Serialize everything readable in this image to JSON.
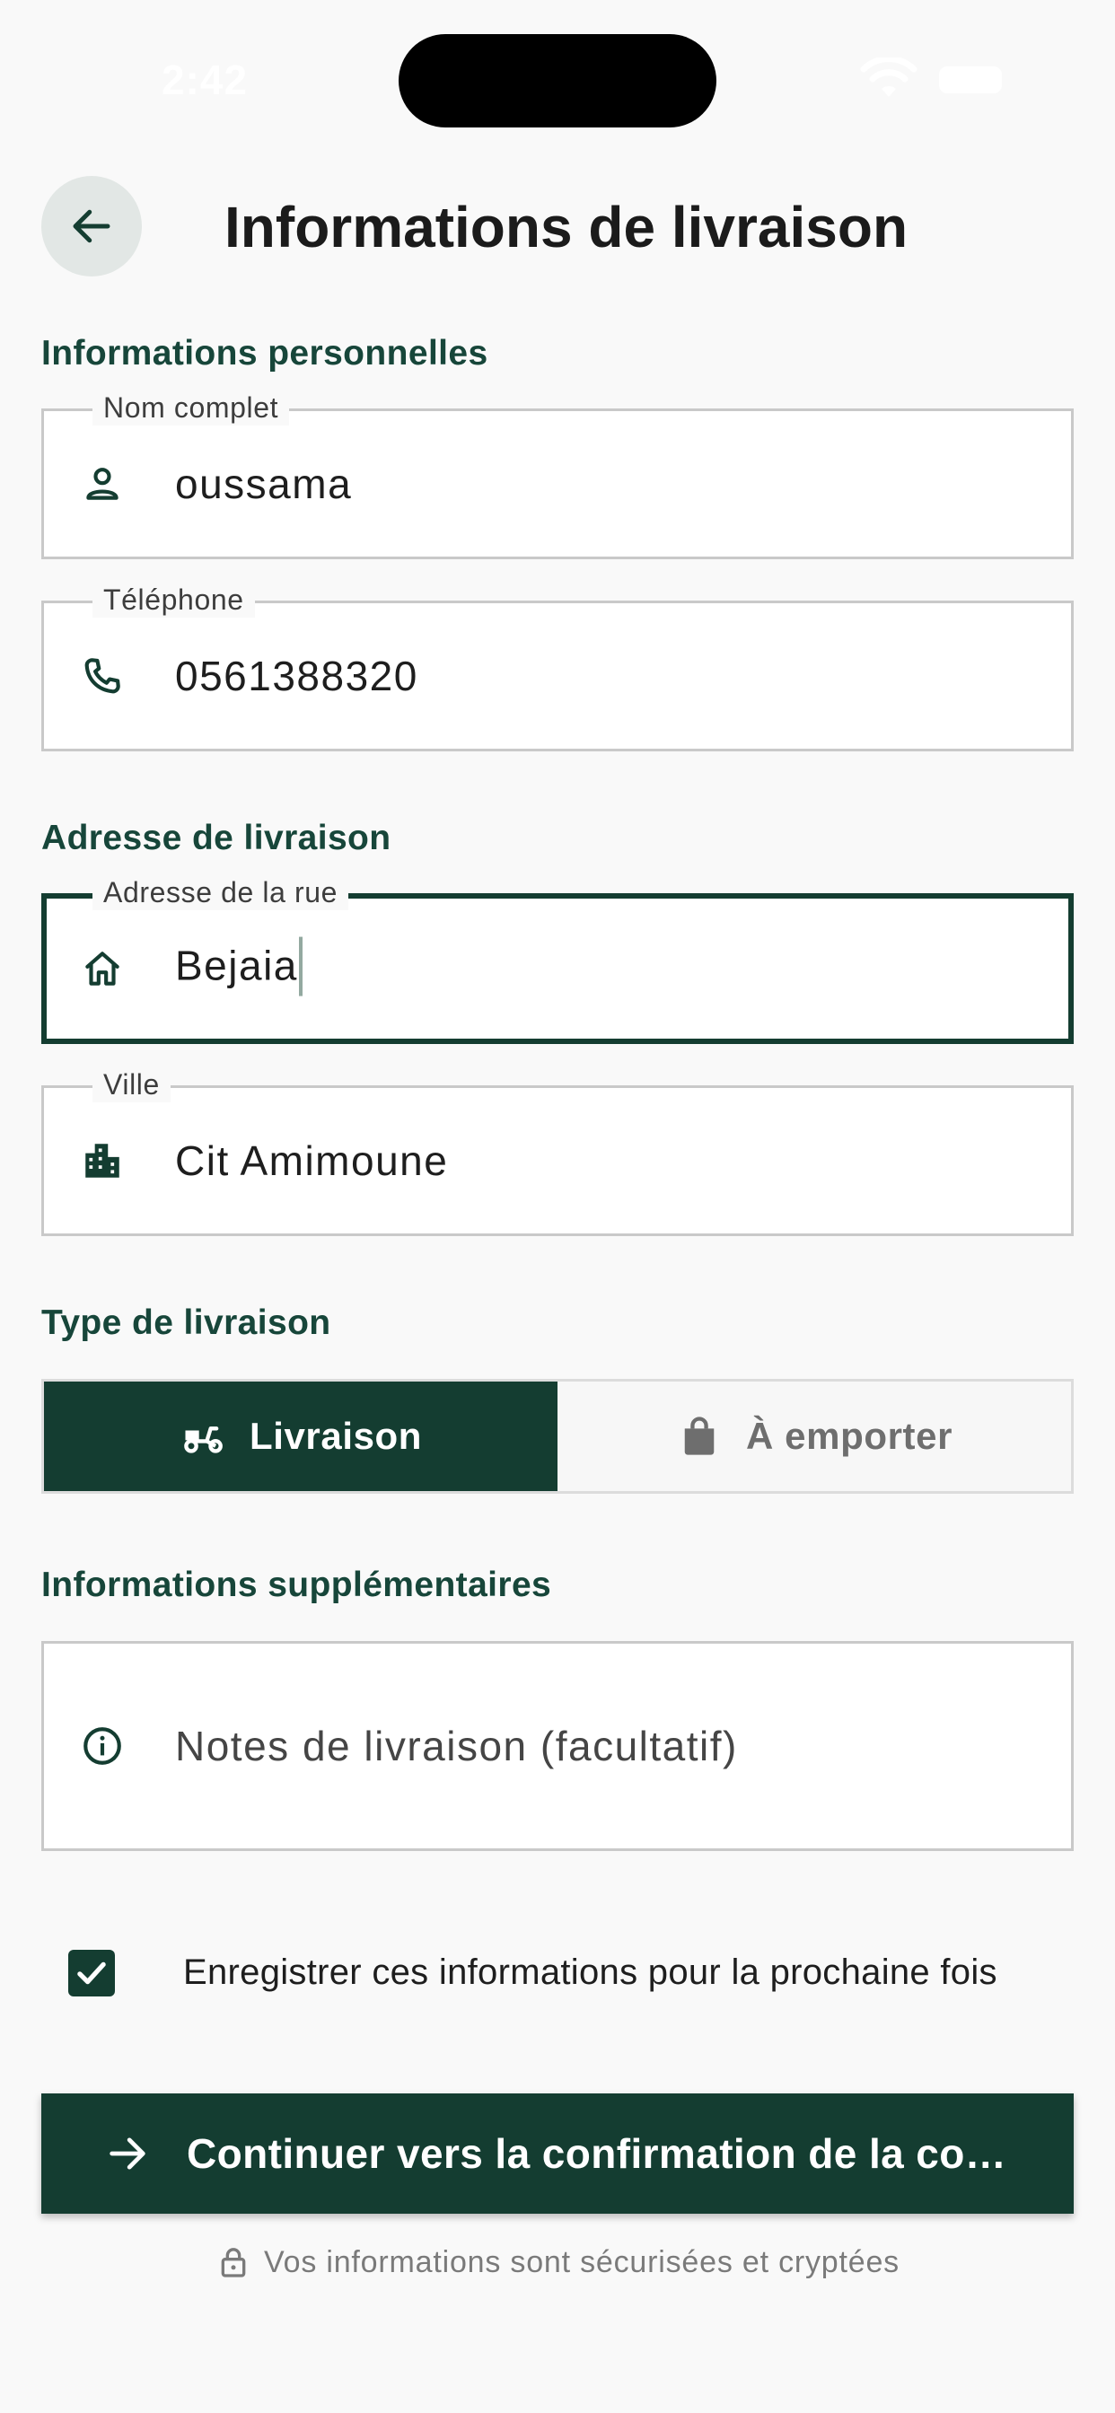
{
  "status_bar": {
    "time": "2:42"
  },
  "header": {
    "title": "Informations de livraison",
    "back_icon": "arrow-left-icon"
  },
  "sections": {
    "personal": "Informations personnelles",
    "address": "Adresse de livraison",
    "delivery_type": "Type de livraison",
    "extra": "Informations supplémentaires"
  },
  "fields": {
    "full_name": {
      "label": "Nom complet",
      "value": "oussama",
      "icon": "person-icon"
    },
    "phone": {
      "label": "Téléphone",
      "value": "0561388320",
      "icon": "phone-icon"
    },
    "street": {
      "label": "Adresse de la rue",
      "value": "Bejaia",
      "icon": "home-icon"
    },
    "city": {
      "label": "Ville",
      "value": "Cit Amimoune",
      "icon": "city-icon"
    },
    "notes": {
      "placeholder": "Notes de livraison (facultatif)",
      "icon": "info-icon"
    }
  },
  "delivery_type": {
    "selected": "Livraison",
    "options": [
      {
        "label": "Livraison",
        "icon": "delivery-scooter-icon"
      },
      {
        "label": "À emporter",
        "icon": "shopping-bag-icon"
      }
    ]
  },
  "save_info": {
    "label": "Enregistrer ces informations pour la prochaine fois",
    "checked": true
  },
  "primary_button": {
    "label": "Continuer vers la confirmation de la commande"
  },
  "footer": {
    "secure_note": "Vos informations sont sécurisées et cryptées"
  },
  "colors": {
    "accent": "#143d31",
    "section_label": "#17463a",
    "background": "#f9f9f9"
  }
}
